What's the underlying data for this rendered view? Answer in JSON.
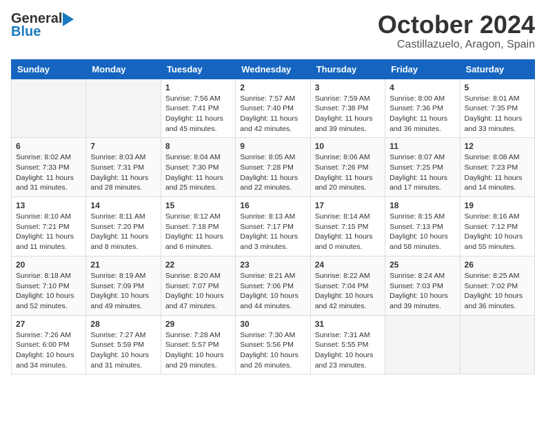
{
  "header": {
    "logo_general": "General",
    "logo_blue": "Blue",
    "month_title": "October 2024",
    "location": "Castillazuelo, Aragon, Spain"
  },
  "calendar": {
    "days_of_week": [
      "Sunday",
      "Monday",
      "Tuesday",
      "Wednesday",
      "Thursday",
      "Friday",
      "Saturday"
    ],
    "weeks": [
      [
        {
          "day": "",
          "info": ""
        },
        {
          "day": "",
          "info": ""
        },
        {
          "day": "1",
          "info": "Sunrise: 7:56 AM\nSunset: 7:41 PM\nDaylight: 11 hours and 45 minutes."
        },
        {
          "day": "2",
          "info": "Sunrise: 7:57 AM\nSunset: 7:40 PM\nDaylight: 11 hours and 42 minutes."
        },
        {
          "day": "3",
          "info": "Sunrise: 7:59 AM\nSunset: 7:38 PM\nDaylight: 11 hours and 39 minutes."
        },
        {
          "day": "4",
          "info": "Sunrise: 8:00 AM\nSunset: 7:36 PM\nDaylight: 11 hours and 36 minutes."
        },
        {
          "day": "5",
          "info": "Sunrise: 8:01 AM\nSunset: 7:35 PM\nDaylight: 11 hours and 33 minutes."
        }
      ],
      [
        {
          "day": "6",
          "info": "Sunrise: 8:02 AM\nSunset: 7:33 PM\nDaylight: 11 hours and 31 minutes."
        },
        {
          "day": "7",
          "info": "Sunrise: 8:03 AM\nSunset: 7:31 PM\nDaylight: 11 hours and 28 minutes."
        },
        {
          "day": "8",
          "info": "Sunrise: 8:04 AM\nSunset: 7:30 PM\nDaylight: 11 hours and 25 minutes."
        },
        {
          "day": "9",
          "info": "Sunrise: 8:05 AM\nSunset: 7:28 PM\nDaylight: 11 hours and 22 minutes."
        },
        {
          "day": "10",
          "info": "Sunrise: 8:06 AM\nSunset: 7:26 PM\nDaylight: 11 hours and 20 minutes."
        },
        {
          "day": "11",
          "info": "Sunrise: 8:07 AM\nSunset: 7:25 PM\nDaylight: 11 hours and 17 minutes."
        },
        {
          "day": "12",
          "info": "Sunrise: 8:08 AM\nSunset: 7:23 PM\nDaylight: 11 hours and 14 minutes."
        }
      ],
      [
        {
          "day": "13",
          "info": "Sunrise: 8:10 AM\nSunset: 7:21 PM\nDaylight: 11 hours and 11 minutes."
        },
        {
          "day": "14",
          "info": "Sunrise: 8:11 AM\nSunset: 7:20 PM\nDaylight: 11 hours and 8 minutes."
        },
        {
          "day": "15",
          "info": "Sunrise: 8:12 AM\nSunset: 7:18 PM\nDaylight: 11 hours and 6 minutes."
        },
        {
          "day": "16",
          "info": "Sunrise: 8:13 AM\nSunset: 7:17 PM\nDaylight: 11 hours and 3 minutes."
        },
        {
          "day": "17",
          "info": "Sunrise: 8:14 AM\nSunset: 7:15 PM\nDaylight: 11 hours and 0 minutes."
        },
        {
          "day": "18",
          "info": "Sunrise: 8:15 AM\nSunset: 7:13 PM\nDaylight: 10 hours and 58 minutes."
        },
        {
          "day": "19",
          "info": "Sunrise: 8:16 AM\nSunset: 7:12 PM\nDaylight: 10 hours and 55 minutes."
        }
      ],
      [
        {
          "day": "20",
          "info": "Sunrise: 8:18 AM\nSunset: 7:10 PM\nDaylight: 10 hours and 52 minutes."
        },
        {
          "day": "21",
          "info": "Sunrise: 8:19 AM\nSunset: 7:09 PM\nDaylight: 10 hours and 49 minutes."
        },
        {
          "day": "22",
          "info": "Sunrise: 8:20 AM\nSunset: 7:07 PM\nDaylight: 10 hours and 47 minutes."
        },
        {
          "day": "23",
          "info": "Sunrise: 8:21 AM\nSunset: 7:06 PM\nDaylight: 10 hours and 44 minutes."
        },
        {
          "day": "24",
          "info": "Sunrise: 8:22 AM\nSunset: 7:04 PM\nDaylight: 10 hours and 42 minutes."
        },
        {
          "day": "25",
          "info": "Sunrise: 8:24 AM\nSunset: 7:03 PM\nDaylight: 10 hours and 39 minutes."
        },
        {
          "day": "26",
          "info": "Sunrise: 8:25 AM\nSunset: 7:02 PM\nDaylight: 10 hours and 36 minutes."
        }
      ],
      [
        {
          "day": "27",
          "info": "Sunrise: 7:26 AM\nSunset: 6:00 PM\nDaylight: 10 hours and 34 minutes."
        },
        {
          "day": "28",
          "info": "Sunrise: 7:27 AM\nSunset: 5:59 PM\nDaylight: 10 hours and 31 minutes."
        },
        {
          "day": "29",
          "info": "Sunrise: 7:28 AM\nSunset: 5:57 PM\nDaylight: 10 hours and 29 minutes."
        },
        {
          "day": "30",
          "info": "Sunrise: 7:30 AM\nSunset: 5:56 PM\nDaylight: 10 hours and 26 minutes."
        },
        {
          "day": "31",
          "info": "Sunrise: 7:31 AM\nSunset: 5:55 PM\nDaylight: 10 hours and 23 minutes."
        },
        {
          "day": "",
          "info": ""
        },
        {
          "day": "",
          "info": ""
        }
      ]
    ]
  }
}
